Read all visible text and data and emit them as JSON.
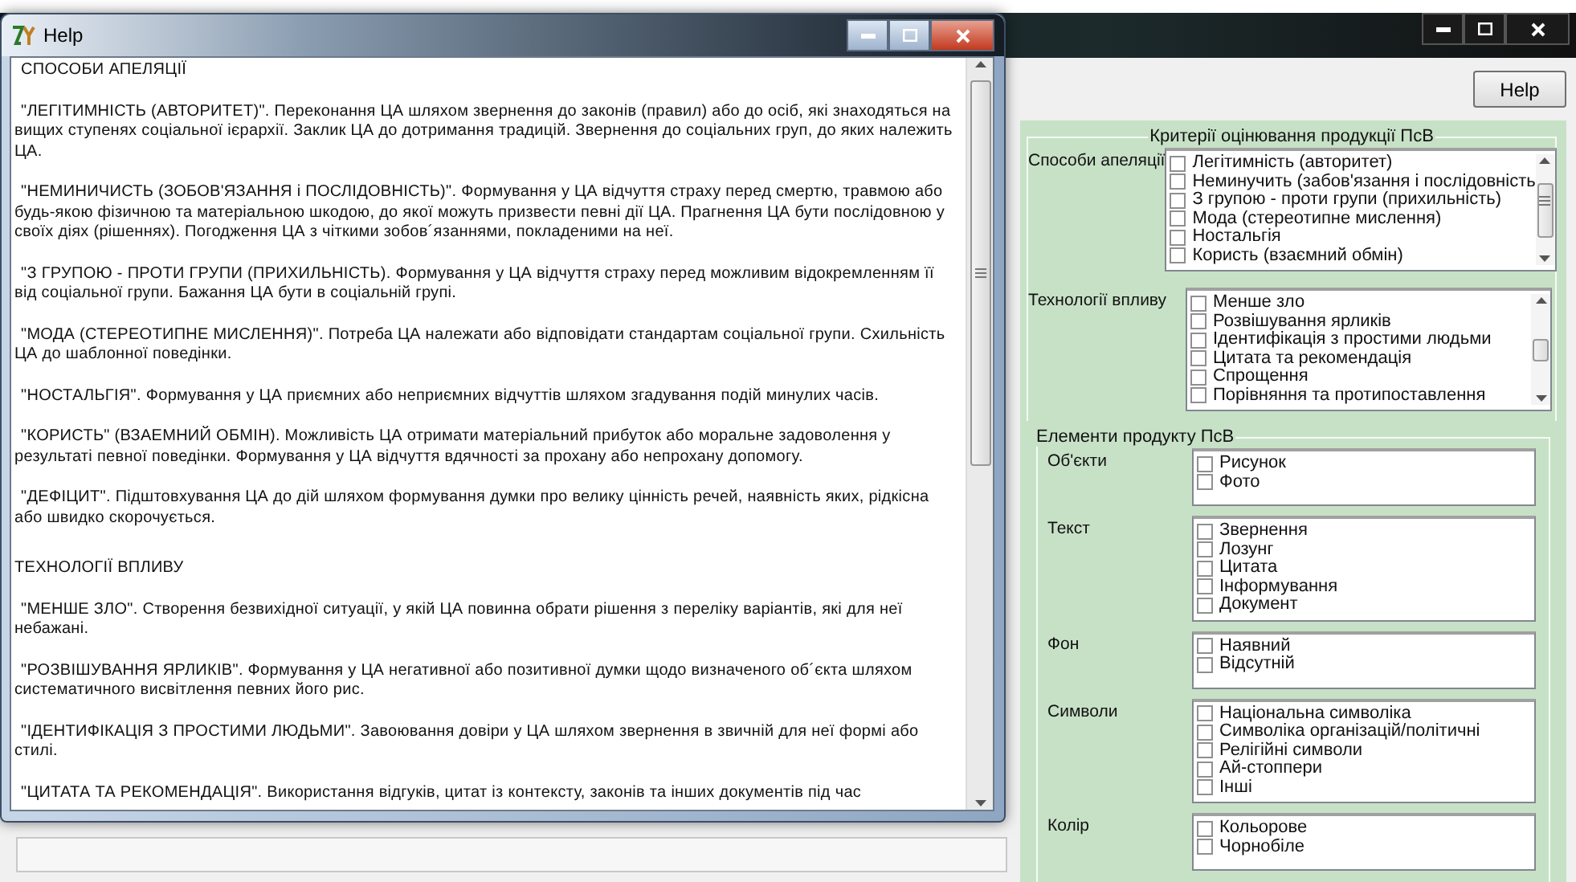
{
  "main_window": {
    "help_button": "Help"
  },
  "help_window": {
    "title": "Help",
    "paragraphs": [
      {
        "kind": "heading",
        "text": "СПОСОБИ АПЕЛЯЦІЇ"
      },
      {
        "kind": "item",
        "text": "\"ЛЕГІТИМНІСТЬ (АВТОРИТЕТ)\". Переконання ЦА шляхом звернення до законів (правил) або до осіб, які знаходяться на вищих ступенях соціальної ієрархії. Заклик ЦА до дотримання традицій. Звернення до соціальних груп, до яких належить ЦА."
      },
      {
        "kind": "item",
        "text": "\"НЕМИНИЧИСТЬ (ЗОБОВ'ЯЗАННЯ і ПОСЛІДОВНІСТЬ)\". Формування у ЦА відчуття страху перед смертю, травмою або будь-якою фізичною та матеріальною шкодою, до якої можуть призвести певні дії ЦА. Прагнення ЦА бути послідовною у своїх діях (рішеннях). Погодження ЦА з чіткими зобов´язаннями, покладеними на неї."
      },
      {
        "kind": "item",
        "text": "\"З ГРУПОЮ - ПРОТИ ГРУПИ (ПРИХИЛЬНІСТЬ). Формування у ЦА відчуття страху перед можливим відокремленням її від соціальної групи. Бажання ЦА бути в соціальній групі."
      },
      {
        "kind": "item",
        "text": "\"МОДА (СТЕРЕОТИПНЕ МИСЛЕННЯ)\". Потреба ЦА належати або відповідати стандартам соціальної групи. Схильність ЦА до шаблонної поведінки."
      },
      {
        "kind": "item",
        "text": "\"НОСТАЛЬГІЯ\". Формування у ЦА приємних або неприємних відчуттів шляхом згадування подій минулих часів."
      },
      {
        "kind": "item",
        "text": "\"КОРИСТЬ\" (ВЗАЕМНИЙ ОБМІН). Можливість ЦА отримати матеріальний прибуток або моральне задоволення у результаті певної поведінки. Формування у ЦА відчуття вдячності за  прохану або непрохану допомогу."
      },
      {
        "kind": "item",
        "text": "\"ДЕФІЦИТ\". Підштовхування ЦА до дій шляхом формування думки про велику цінність речей, наявність яких, рідкісна або швидко скорочується."
      },
      {
        "kind": "heading",
        "text": "ТЕХНОЛОГІЇ ВПЛИВУ"
      },
      {
        "kind": "item",
        "text": "\"МЕНШЕ ЗЛО\". Створення безвихідної ситуації, у якій ЦА повинна обрати рішення з переліку варіантів, які для неї небажані."
      },
      {
        "kind": "item",
        "text": "\"РОЗВІШУВАННЯ ЯРЛИКІВ\". Формування у ЦА негативної або позитивної думки щодо визначеного об´єкта шляхом систематичного висвітлення певних його рис."
      },
      {
        "kind": "item",
        "text": "\"ІДЕНТИФІКАЦІЯ З ПРОСТИМИ ЛЮДЬМИ\". Завоювання довіри у ЦА шляхом звернення в звичній для неї формі або стилі."
      },
      {
        "kind": "item",
        "text": "\"ЦИТАТА ТА РЕКОМЕНДАЦІЯ\". Використання відгуків, цитат із контексту, законів та інших документів під час"
      }
    ]
  },
  "criteria": {
    "title": "Критерії оцінювання продукції ПсВ",
    "groups": [
      {
        "label": "Способи апеляції",
        "items": [
          {
            "label": "Легітимність (авторитет)",
            "checked": false
          },
          {
            "label": "Неминучить (забов'язання і послідовність",
            "checked": false
          },
          {
            "label": "З групою - проти групи (прихильність)",
            "checked": false
          },
          {
            "label": "Мода (стереотипне мислення)",
            "checked": false
          },
          {
            "label": "Ностальгія",
            "checked": false
          },
          {
            "label": "Користь (взаємний обмін)",
            "checked": false
          }
        ]
      },
      {
        "label": "Технології впливу",
        "items": [
          {
            "label": "Менше зло",
            "checked": false
          },
          {
            "label": "Розвішування ярликів",
            "checked": false
          },
          {
            "label": "Ідентифікація з простими людьми",
            "checked": false
          },
          {
            "label": "Цитата та рекомендація",
            "checked": false
          },
          {
            "label": "Спрощення",
            "checked": false
          },
          {
            "label": "Порівняння та протипоставлення",
            "checked": false
          }
        ]
      }
    ]
  },
  "elements": {
    "title": "Елементи продукту ПсВ",
    "groups": [
      {
        "label": "Об'єкти",
        "items": [
          {
            "label": "Рисунок",
            "checked": false
          },
          {
            "label": "Фото",
            "checked": false
          }
        ]
      },
      {
        "label": "Текст",
        "items": [
          {
            "label": "Звернення",
            "checked": false
          },
          {
            "label": "Лозунг",
            "checked": false
          },
          {
            "label": "Цитата",
            "checked": false
          },
          {
            "label": "Інформування",
            "checked": false
          },
          {
            "label": "Документ",
            "checked": false
          }
        ]
      },
      {
        "label": "Фон",
        "items": [
          {
            "label": "Наявний",
            "checked": false
          },
          {
            "label": "Відсутній",
            "checked": false
          }
        ]
      },
      {
        "label": "Символи",
        "items": [
          {
            "label": "Національна символіка",
            "checked": false
          },
          {
            "label": "Символіка організацій/політичні",
            "checked": false
          },
          {
            "label": "Релігійні символи",
            "checked": false
          },
          {
            "label": "Ай-стоппери",
            "checked": false
          },
          {
            "label": "Інші",
            "checked": false
          }
        ]
      },
      {
        "label": "Колір",
        "items": [
          {
            "label": "Кольорове",
            "checked": false
          },
          {
            "label": "Чорнобіле",
            "checked": false
          }
        ]
      }
    ]
  }
}
